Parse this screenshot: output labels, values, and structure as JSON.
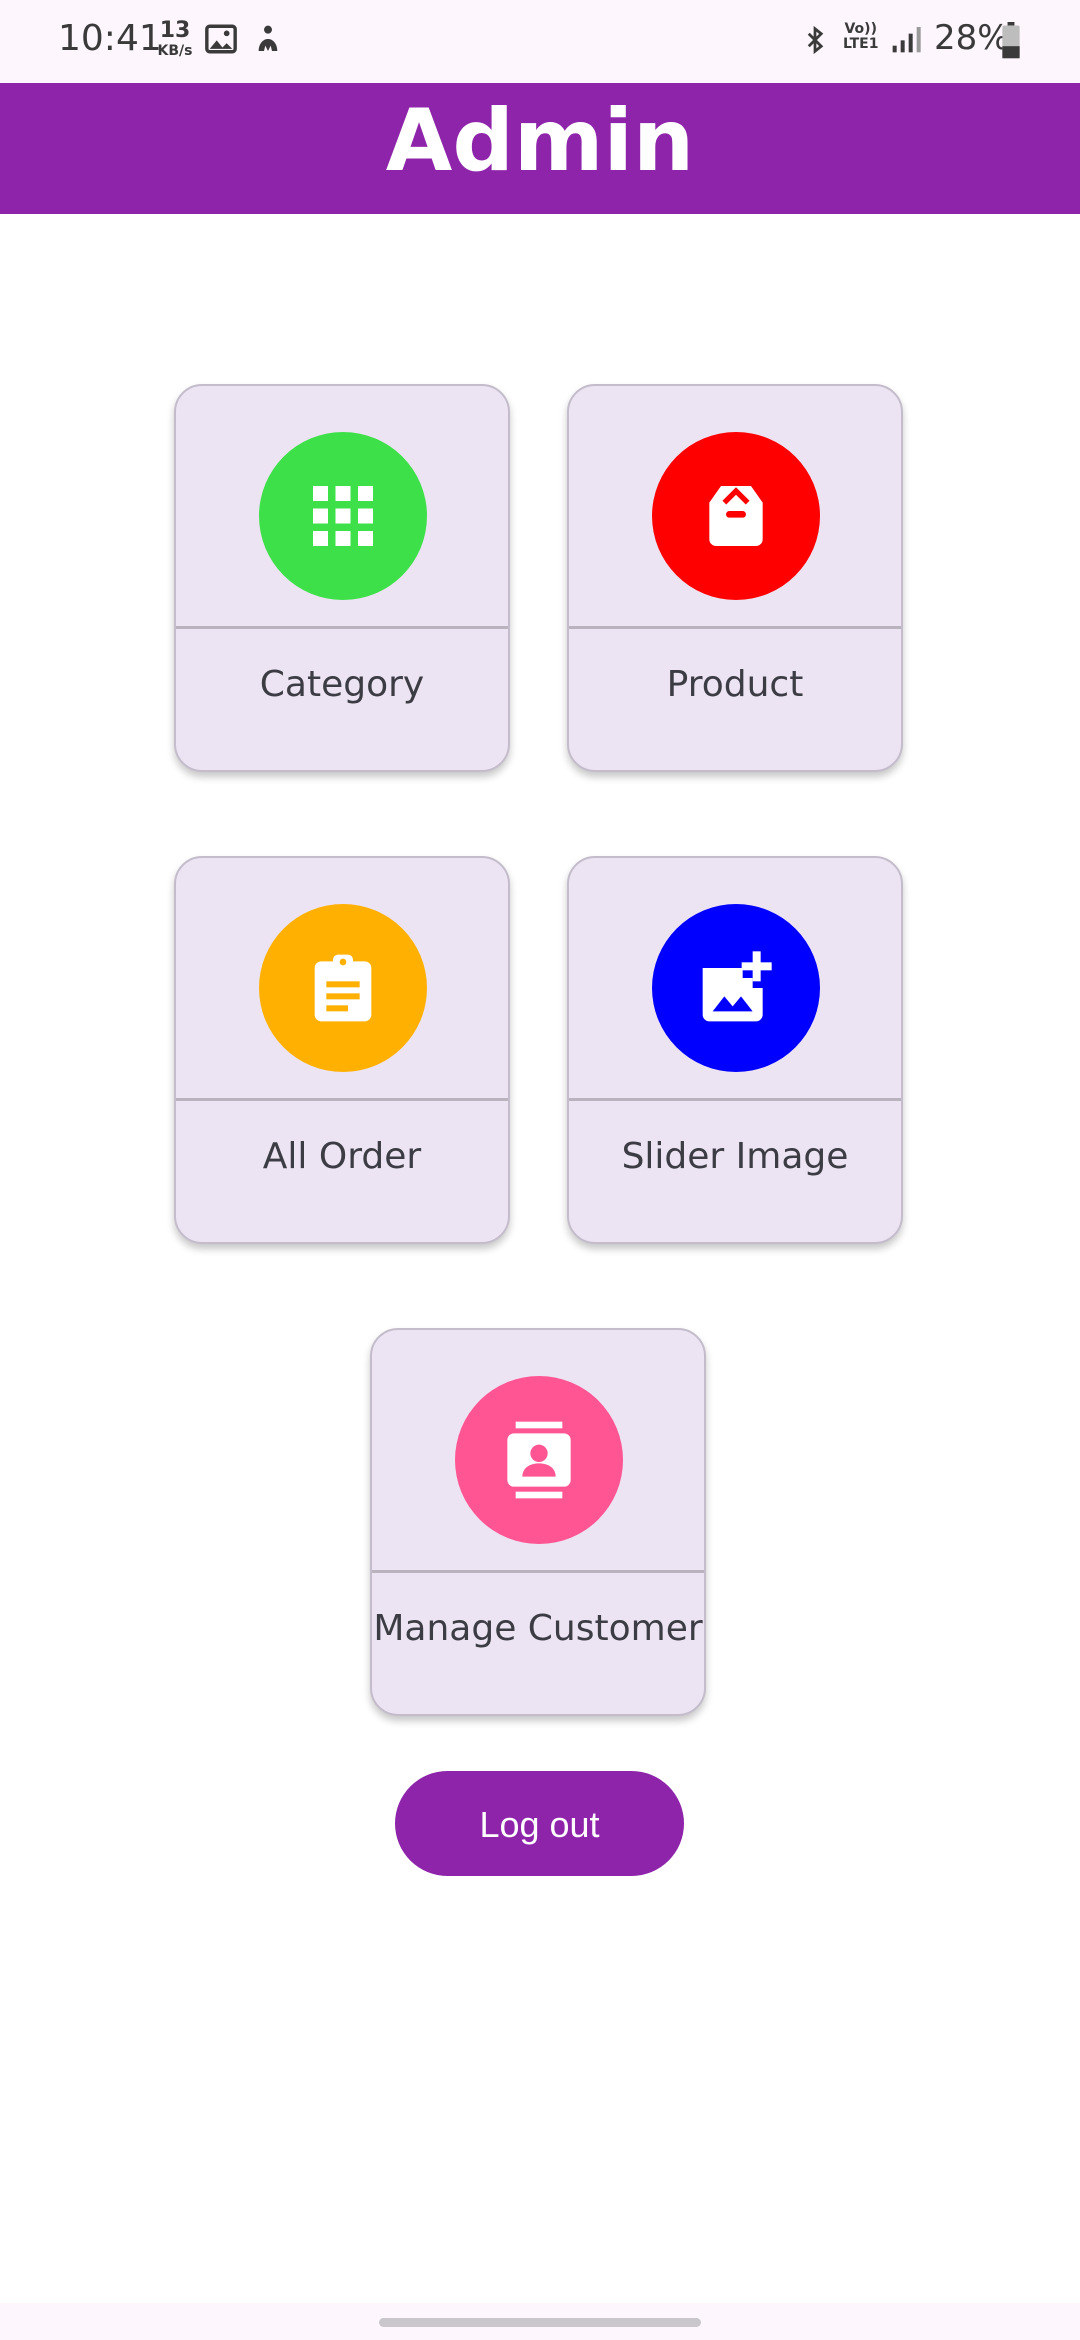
{
  "status_bar": {
    "time": "10:41",
    "net_speed_value": "13",
    "net_speed_unit": "KB/s",
    "volte_top": "Vo))",
    "volte_bottom": "LTE1",
    "battery_percent": "28%"
  },
  "app_bar": {
    "title": "Admin"
  },
  "menu": {
    "category": {
      "label": "Category",
      "icon": "grid-icon",
      "color": "#3ee04a"
    },
    "product": {
      "label": "Product",
      "icon": "package-icon",
      "color": "#ff0000"
    },
    "all_order": {
      "label": "All Order",
      "icon": "clipboard-icon",
      "color": "#ffb000"
    },
    "slider_image": {
      "label": "Slider Image",
      "icon": "add-photo-icon",
      "color": "#0000ff"
    },
    "manage_customer": {
      "label": "Manage Customer",
      "icon": "contacts-icon",
      "color": "#ff5593"
    }
  },
  "logout_button": {
    "label": "Log out"
  },
  "colors": {
    "primary": "#8e24aa",
    "card_bg": "#ece4f3"
  }
}
